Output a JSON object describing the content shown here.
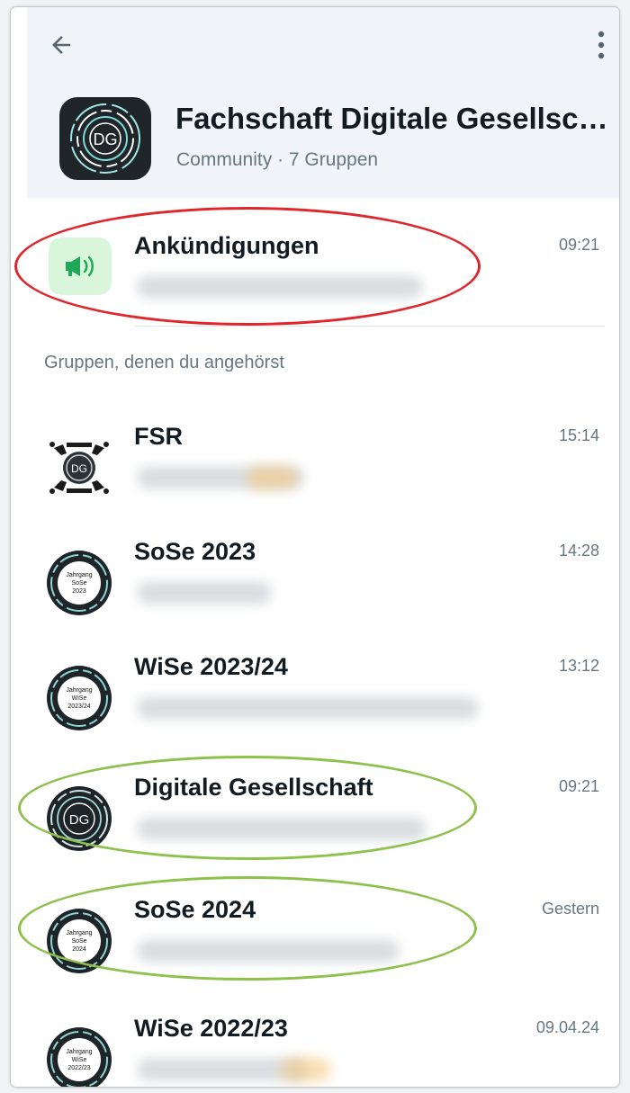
{
  "header": {
    "back_icon": "arrow-left-icon",
    "more_icon": "more-vert-icon",
    "avatar_text": "DG",
    "title": "Fachschaft Digitale Gesellsc…",
    "subtitle": "Community · 7 Gruppen"
  },
  "announcements": {
    "name": "Ankündigungen",
    "time": "09:21",
    "icon": "megaphone-icon"
  },
  "section_label": "Gruppen, denen du angehörst",
  "groups": [
    {
      "name": "FSR",
      "time": "15:14",
      "avatar_text": "DG"
    },
    {
      "name": "SoSe 2023",
      "time": "14:28",
      "badge": [
        "Jahrgang",
        "SoSe",
        "2023"
      ]
    },
    {
      "name": "WiSe 2023/24",
      "time": "13:12",
      "badge": [
        "Jahrgang",
        "WiSe",
        "2023/24"
      ]
    },
    {
      "name": "Digitale Gesellschaft",
      "time": "09:21",
      "avatar_text": "DG"
    },
    {
      "name": "SoSe 2024",
      "time": "Gestern",
      "badge": [
        "Jahrgang",
        "SoSe",
        "2024"
      ]
    },
    {
      "name": "WiSe 2022/23",
      "time": "09.04.24",
      "badge": [
        "Jahrgang",
        "WiSe",
        "2022/23"
      ]
    }
  ],
  "colors": {
    "header_bg": "#f1f5fa",
    "announce_bg": "#d9f5dc",
    "announce_icon": "#1fa855",
    "highlight_red": "#e0262d",
    "highlight_green": "#8dc14c"
  }
}
